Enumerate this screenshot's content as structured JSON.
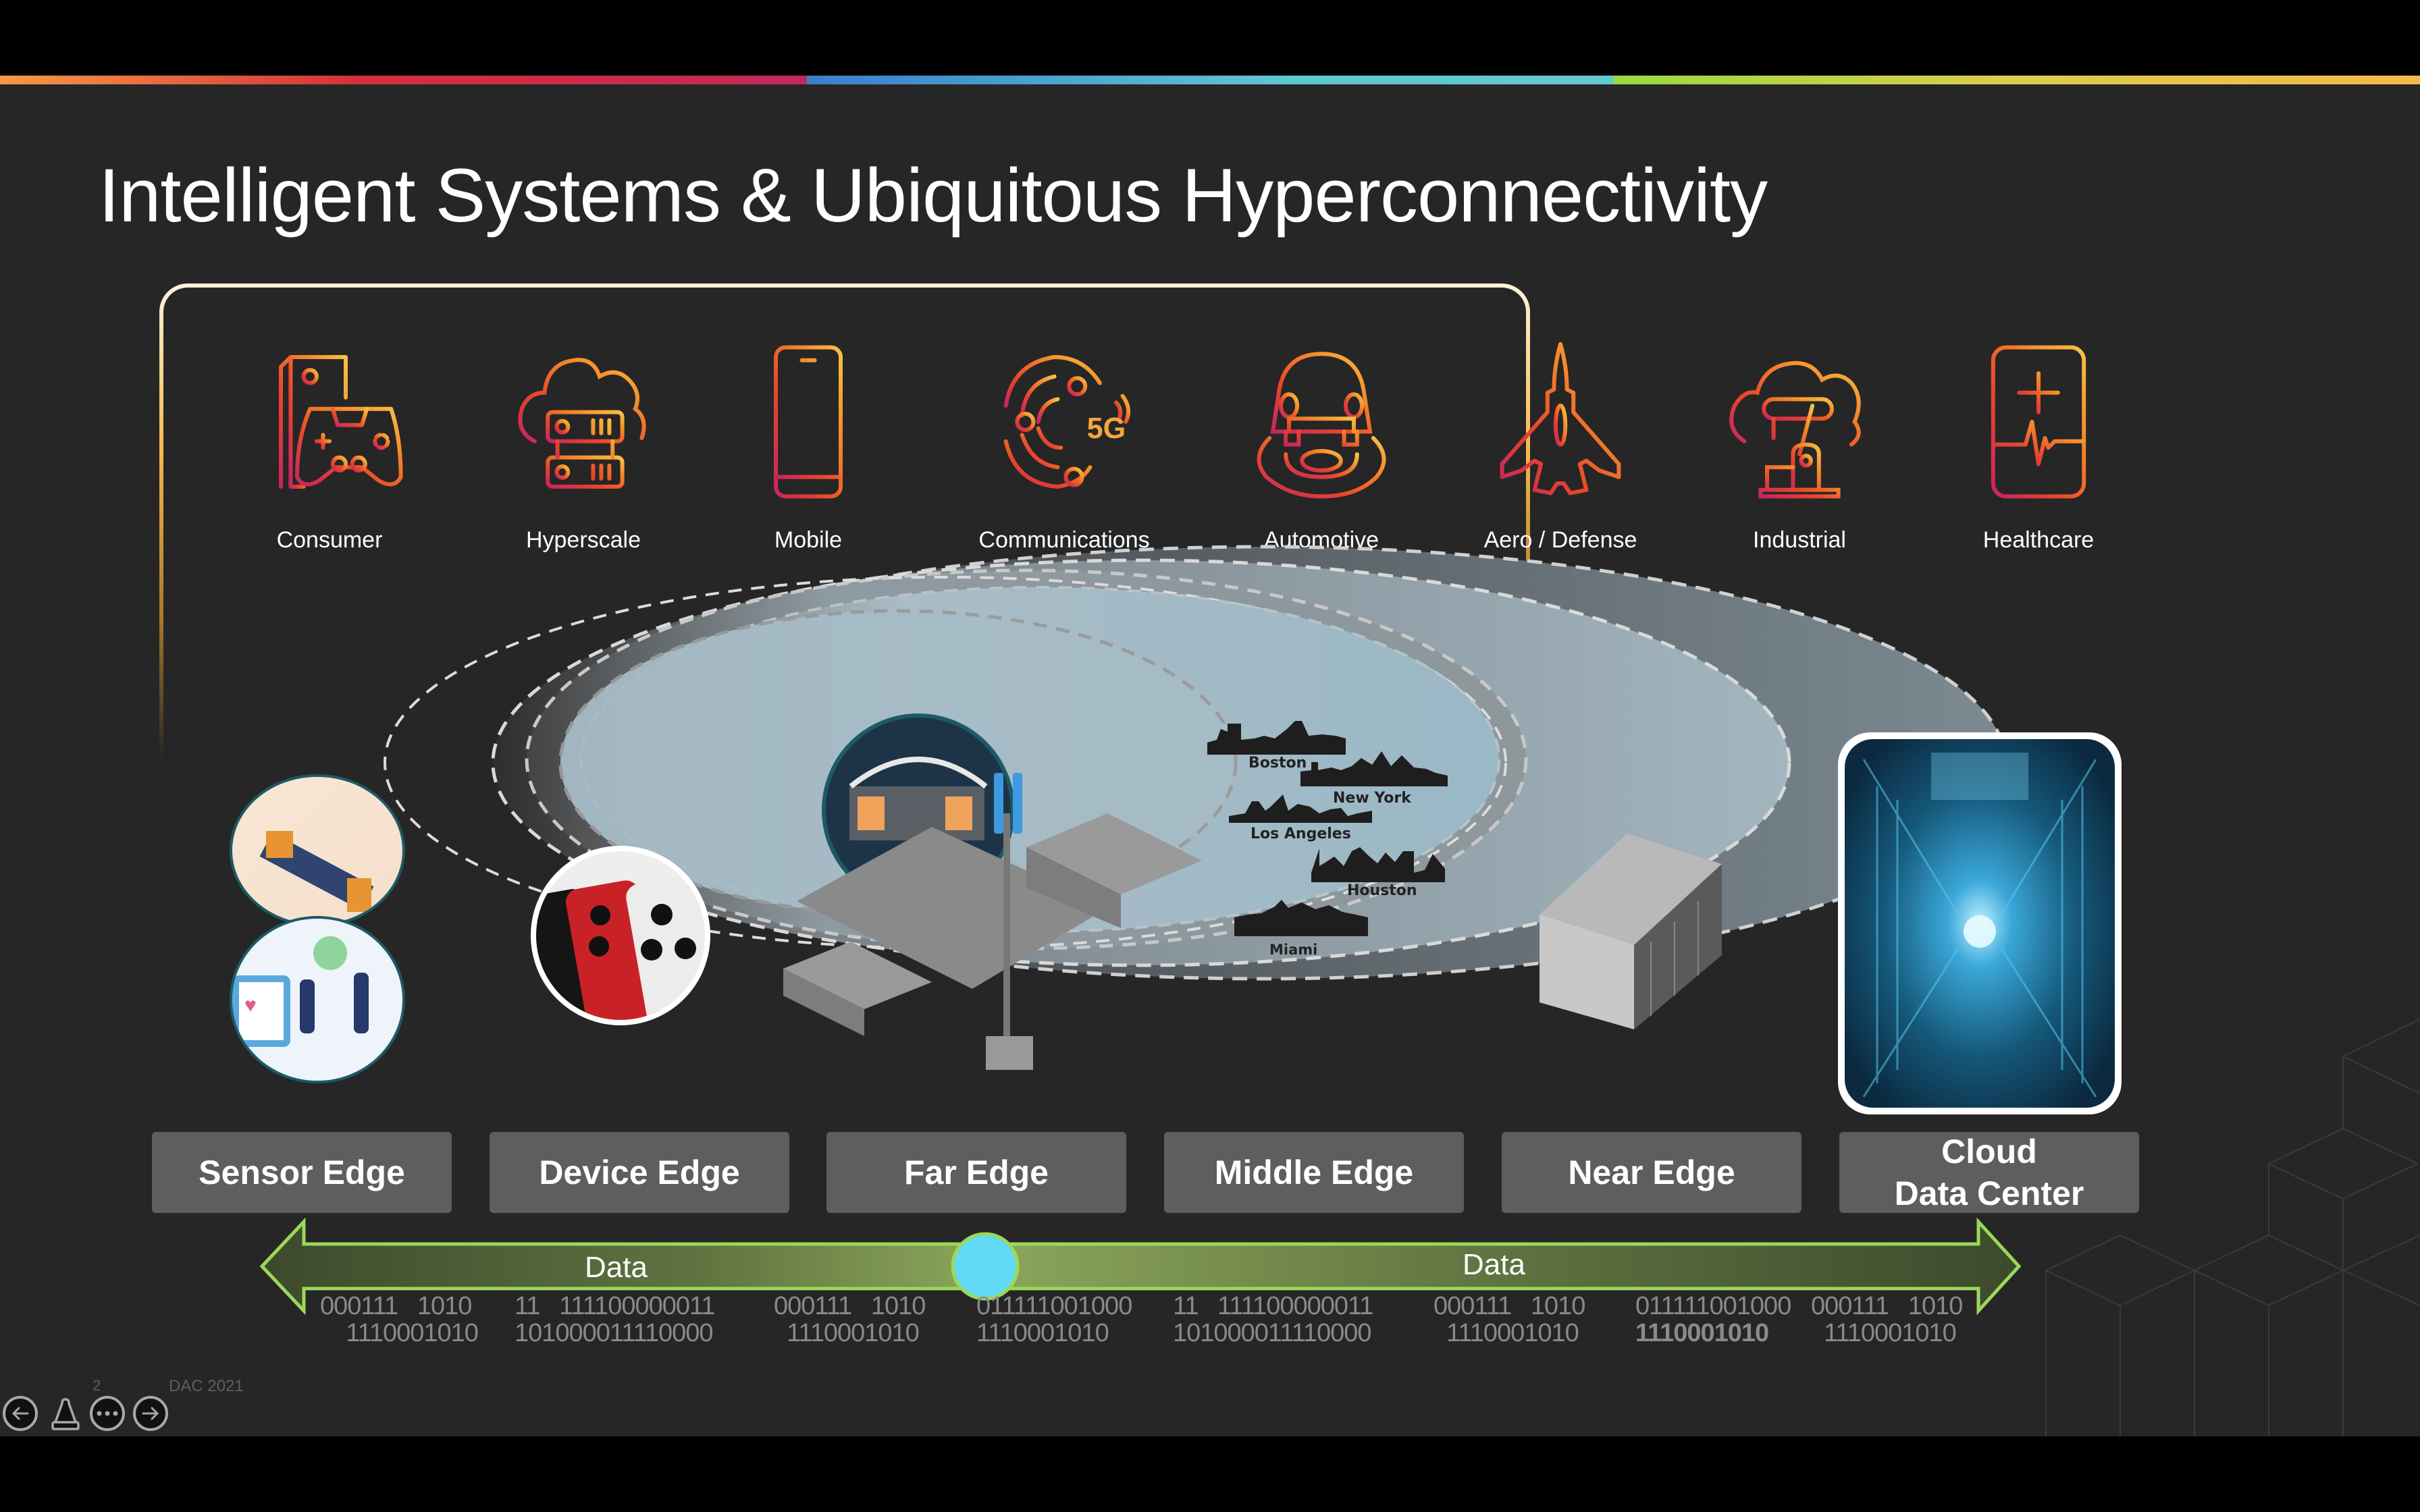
{
  "slide": {
    "title": "Intelligent Systems & Ubiquitous Hyperconnectivity",
    "page_number": "2",
    "footer_label": "DAC 2021"
  },
  "colors": {
    "stripe": [
      "#f59a45",
      "#d32f3a",
      "#c2295a",
      "#3a7fcc",
      "#5fc7d2",
      "#9bd842",
      "#f4b946"
    ],
    "icon_gradient": [
      "#c8245e",
      "#e8462c",
      "#f58a2a",
      "#f8c146"
    ],
    "edge_box": "#5e5e5e",
    "data_arrow": "#9bd85a",
    "midpoint": "#62d9f5",
    "background": "#262626"
  },
  "industries": [
    {
      "label": "Consumer",
      "icon": "console-gamepad-icon"
    },
    {
      "label": "Hyperscale",
      "icon": "cloud-server-icon"
    },
    {
      "label": "Mobile",
      "icon": "smartphone-icon"
    },
    {
      "label": "Communications",
      "icon": "5g-signal-icon"
    },
    {
      "label": "Automotive",
      "icon": "car-sensor-icon"
    },
    {
      "label": "Aero / Defense",
      "icon": "jet-icon"
    },
    {
      "label": "Industrial",
      "icon": "robot-arm-cloud-icon"
    },
    {
      "label": "Healthcare",
      "icon": "medical-heartbeat-icon"
    }
  ],
  "illustrations": {
    "sensor": [
      "factory-automation-image",
      "wearable-fitness-image"
    ],
    "device": "smartphones-image",
    "far": "stadium-cell-tower-image",
    "cities": [
      "Boston",
      "New York",
      "Los Angeles",
      "Houston",
      "Miami"
    ],
    "near": "server-rack-image",
    "cloud": "data-center-image"
  },
  "edges": [
    {
      "label": "Sensor Edge"
    },
    {
      "label": "Device Edge"
    },
    {
      "label": "Far Edge"
    },
    {
      "label": "Middle Edge"
    },
    {
      "label": "Near Edge"
    },
    {
      "label": "Cloud\nData Center"
    }
  ],
  "data_flow": {
    "left_label": "Data",
    "right_label": "Data"
  },
  "bits": [
    {
      "text": "000111   1010\n    1110001010",
      "bold": false
    },
    {
      "text": "11   111100000011\n101000011110000",
      "bold": false
    },
    {
      "text": "000111   1010\n  1110001010",
      "bold": false
    },
    {
      "text": "011111001000\n1110001010",
      "bold": false
    },
    {
      "text": "11   111100000011\n101000011110000",
      "bold": false
    },
    {
      "text": "000111   1010\n  1110001010",
      "bold": false
    },
    {
      "text": "011111001000\n1110001010",
      "bold_second": true
    },
    {
      "text": "000111   1010\n  1110001010",
      "bold": false
    }
  ]
}
